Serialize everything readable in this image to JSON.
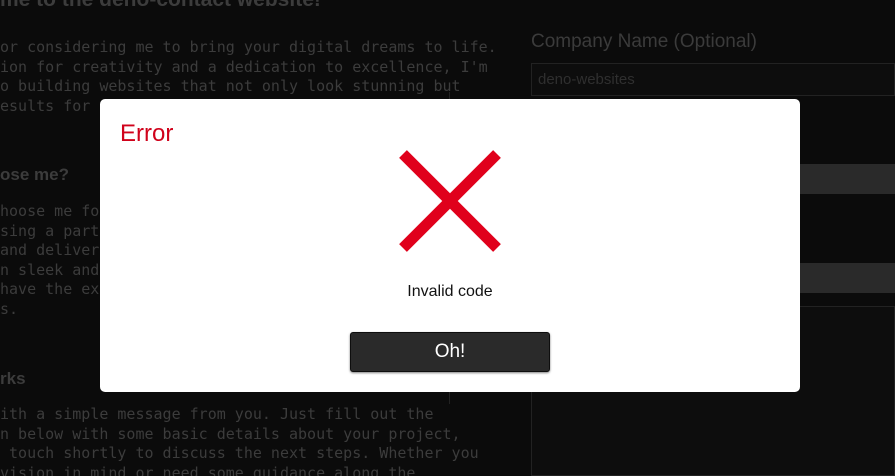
{
  "background": {
    "left": {
      "title": "me to the deno-contact website!",
      "intro": "or considering me to bring your digital dreams to life.\nion for creativity and a dedication to excellence, I'm\no building websites that not only look stunning but\nesults for your b",
      "section1_heading": "ose me?",
      "section1_text": "hoose me for y\nsing a partner w\nand delivers a\nn sleek and mo\nhave the exper\ns.",
      "section2_heading": "rks",
      "section2_text": "ith a simple message from you. Just fill out the\nn below with some basic details about your project,\n touch shortly to discuss the next steps. Whether you\nvision in mind or need some guidance along the"
    },
    "right": {
      "company_label": "Company Name (Optional)",
      "company_value": "deno-websites"
    }
  },
  "modal": {
    "title": "Error",
    "icon": "error-x-icon",
    "message": "Invalid code",
    "button_label": "Oh!",
    "title_color": "#d0021b",
    "icon_color": "#e0001b"
  }
}
